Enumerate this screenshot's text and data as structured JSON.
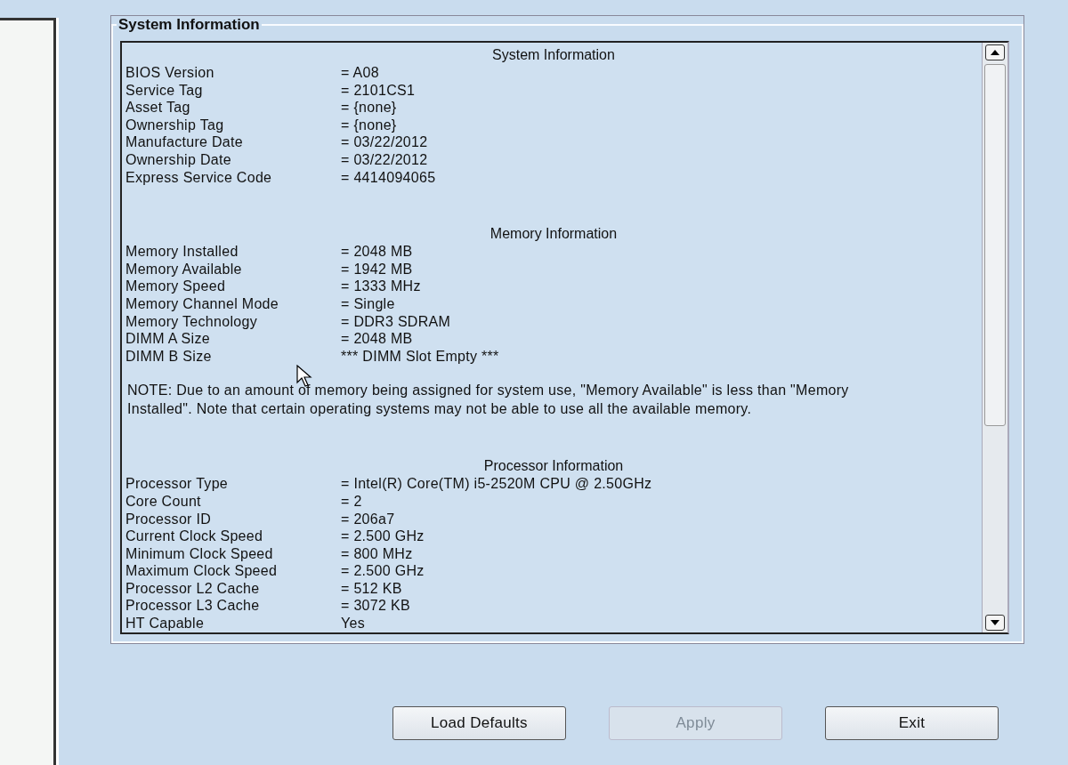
{
  "group_title": "System Information",
  "sections": [
    {
      "heading": "System Information",
      "rows": [
        {
          "label": "BIOS Version",
          "value": "= A08"
        },
        {
          "label": "Service Tag",
          "value": "= 2101CS1"
        },
        {
          "label": "Asset Tag",
          "value": "= {none}"
        },
        {
          "label": "Ownership Tag",
          "value": "= {none}"
        },
        {
          "label": "Manufacture Date",
          "value": "= 03/22/2012"
        },
        {
          "label": "Ownership Date",
          "value": "= 03/22/2012"
        },
        {
          "label": "Express Service Code",
          "value": "= 4414094065"
        }
      ]
    },
    {
      "heading": "Memory Information",
      "rows": [
        {
          "label": "Memory Installed",
          "value": "= 2048 MB"
        },
        {
          "label": "Memory Available",
          "value": "= 1942 MB"
        },
        {
          "label": "Memory Speed",
          "value": "= 1333 MHz"
        },
        {
          "label": "Memory Channel Mode",
          "value": "= Single"
        },
        {
          "label": "Memory Technology",
          "value": "= DDR3 SDRAM"
        },
        {
          "label": "DIMM A Size",
          "value": "= 2048 MB"
        },
        {
          "label": "DIMM B Size",
          "value": "*** DIMM Slot Empty ***"
        }
      ],
      "note": "NOTE: Due to an amount of memory being assigned for system use, \"Memory Available\" is less than \"Memory Installed\". Note that certain operating systems may not be able to use all the available memory."
    },
    {
      "heading": "Processor Information",
      "rows": [
        {
          "label": "Processor Type",
          "value": "= Intel(R) Core(TM) i5-2520M CPU @ 2.50GHz"
        },
        {
          "label": "Core Count",
          "value": "= 2"
        },
        {
          "label": "Processor ID",
          "value": "= 206a7"
        },
        {
          "label": "Current Clock Speed",
          "value": "= 2.500 GHz"
        },
        {
          "label": "Minimum Clock Speed",
          "value": "= 800 MHz"
        },
        {
          "label": "Maximum Clock Speed",
          "value": "= 2.500 GHz"
        },
        {
          "label": "Processor L2 Cache",
          "value": "= 512 KB"
        },
        {
          "label": "Processor L3 Cache",
          "value": "= 3072 KB"
        },
        {
          "label": "HT Capable",
          "value": "Yes"
        }
      ]
    }
  ],
  "buttons": [
    {
      "label": "Load Defaults",
      "disabled": false
    },
    {
      "label": "Apply",
      "disabled": true
    },
    {
      "label": "Exit",
      "disabled": false
    }
  ]
}
